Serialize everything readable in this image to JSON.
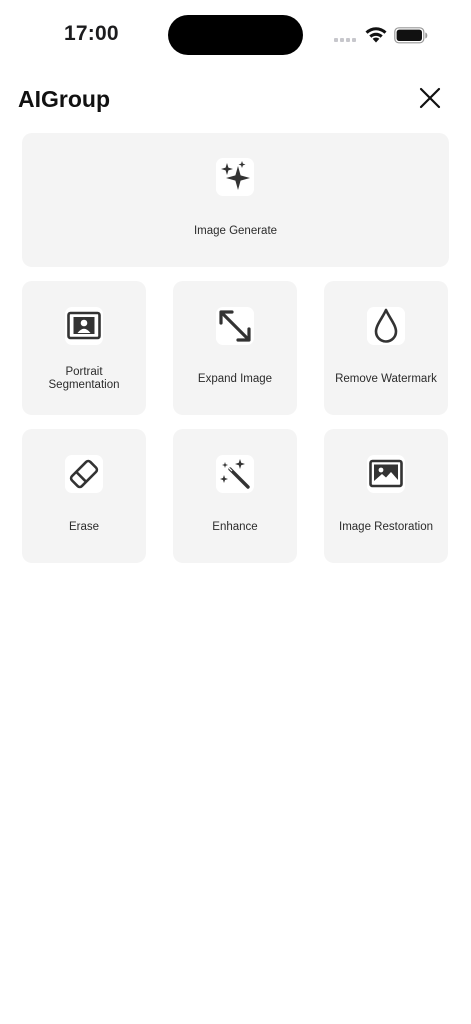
{
  "status_bar": {
    "time": "17:00"
  },
  "header": {
    "title": "AIGroup"
  },
  "tools": {
    "image_generate": {
      "label": "Image Generate",
      "icon": "sparkles-icon"
    },
    "portrait_segmentation": {
      "label_line1": "Portrait",
      "label_line2": "Segmentation",
      "icon": "portrait-frame-icon"
    },
    "expand_image": {
      "label": "Expand Image",
      "icon": "expand-arrows-icon"
    },
    "remove_watermark": {
      "label": "Remove Watermark",
      "icon": "drop-icon"
    },
    "erase": {
      "label": "Erase",
      "icon": "eraser-icon"
    },
    "enhance": {
      "label": "Enhance",
      "icon": "magic-wand-icon"
    },
    "image_restoration": {
      "label": "Image Restoration",
      "icon": "photo-icon"
    }
  },
  "colors": {
    "tile_bg": "#f4f4f4",
    "icon": "#333333",
    "text": "#2b2b2b"
  }
}
